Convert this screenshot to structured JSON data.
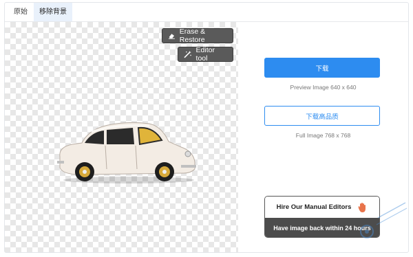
{
  "tabs": [
    {
      "label": "原始",
      "active": false
    },
    {
      "label": "移除背景",
      "active": true
    }
  ],
  "canvas": {
    "erase_restore_label": "Erase & Restore",
    "editor_tool_label": "Editor tool"
  },
  "sidebar": {
    "download_label": "下载",
    "preview_caption": "Preview Image  640 x 640",
    "download_hq_label": "下载高品质",
    "full_caption": "Full Image  768 x 768",
    "hire_label": "Hire Our Manual Editors",
    "hire_subtitle": "Have image back within 24 hours"
  },
  "colors": {
    "accent": "#2d8cf0",
    "dark_button": "#5a5a5a"
  }
}
